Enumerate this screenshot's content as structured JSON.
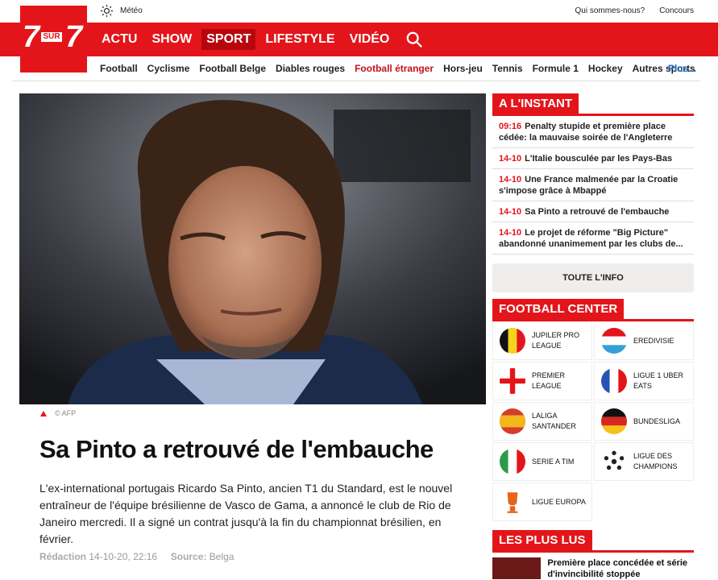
{
  "topbar": {
    "meteo_label": "Météo",
    "links": [
      "Qui sommes-nous?",
      "Concours"
    ]
  },
  "logo": {
    "left": "7",
    "sur": "SUR",
    "right": "7"
  },
  "mainnav": [
    {
      "label": "ACTU"
    },
    {
      "label": "SHOW"
    },
    {
      "label": "SPORT",
      "active": true
    },
    {
      "label": "LIFESTYLE"
    },
    {
      "label": "VIDÉO"
    }
  ],
  "subnav": [
    "Football",
    "Cyclisme",
    "Football Belge",
    "Diables rouges",
    "Football étranger",
    "Hors-jeu",
    "Tennis",
    "Formule 1",
    "Hockey",
    "Autres sports"
  ],
  "subnav_highlight": "Football étranger",
  "subnav_more": "Plus...",
  "article": {
    "credit": "© AFP",
    "title": "Sa Pinto a retrouvé de l'embauche",
    "lead": "L'ex-international portugais Ricardo Sa Pinto, ancien T1 du Standard, est le nouvel entraîneur de l'équipe brésilienne de Vasco de Gama, a annoncé le club de Rio de Janeiro mercredi. Il a signé un contrat jusqu'à la fin du championnat brésilien, en février.",
    "meta_label": "Rédaction",
    "meta_date": "14-10-20, 22:16",
    "source_label": "Source:",
    "source": "Belga"
  },
  "instant": {
    "heading": "A L'INSTANT",
    "items": [
      {
        "time": "09:16",
        "text": "Penalty stupide et première place cédée: la mauvaise soirée de l'Angleterre"
      },
      {
        "time": "14-10",
        "text": "L'Italie bousculée par les Pays-Bas"
      },
      {
        "time": "14-10",
        "text": "Une France malmenée par la Croatie s'impose grâce à Mbappé"
      },
      {
        "time": "14-10",
        "text": "Sa Pinto a retrouvé de l'embauche"
      },
      {
        "time": "14-10",
        "text": "Le projet de réforme \"Big Picture\" abandonné unanimement par les clubs de..."
      }
    ],
    "all_button": "TOUTE L'INFO"
  },
  "football_center": {
    "heading": "FOOTBALL CENTER",
    "leagues": [
      {
        "label": "JUPILER PRO LEAGUE",
        "flag": "belgium"
      },
      {
        "label": "EREDIVISIE",
        "flag": "luxembourg"
      },
      {
        "label": "PREMIER LEAGUE",
        "flag": "england"
      },
      {
        "label": "LIGUE 1 UBER EATS",
        "flag": "france"
      },
      {
        "label": "LALIGA SANTANDER",
        "flag": "spain"
      },
      {
        "label": "BUNDESLIGA",
        "flag": "germany"
      },
      {
        "label": "SERIE A TIM",
        "flag": "italy"
      },
      {
        "label": "LIGUE DES CHAMPIONS",
        "flag": "champions-ball"
      },
      {
        "label": "LIGUE EUROPA",
        "flag": "europa-trophy"
      }
    ]
  },
  "plus_lus": {
    "heading": "LES PLUS LUS",
    "first_item": "Première place concédée et série d'invincibilité stoppée"
  },
  "colors": {
    "brand": "#e3151a",
    "brand_dark": "#b8070c",
    "link_blue": "#2a6fbf"
  }
}
